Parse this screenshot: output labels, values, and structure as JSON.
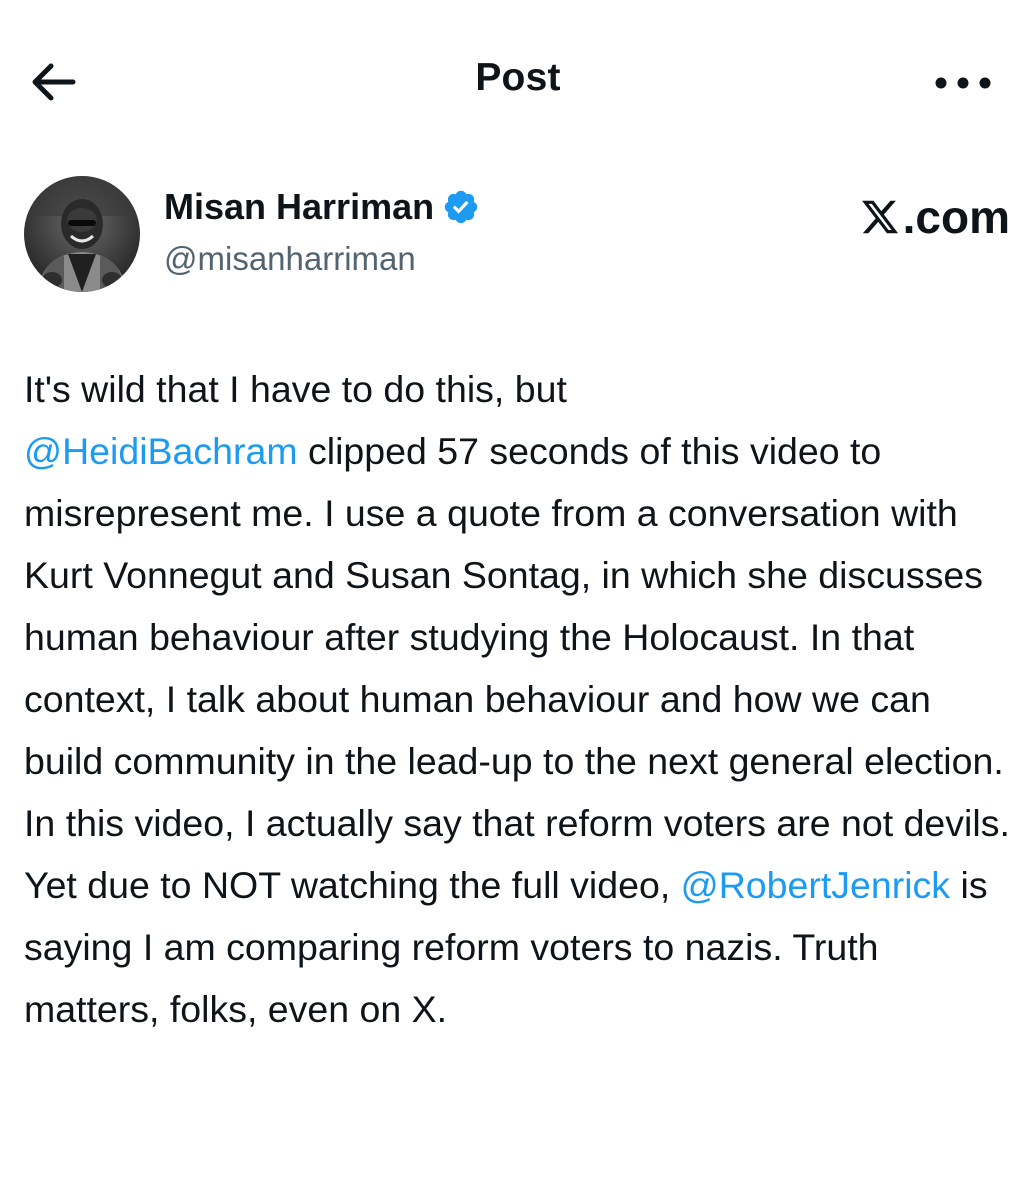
{
  "header": {
    "back_icon": "arrow-left-icon",
    "title": "Post",
    "more_icon": "more-horizontal-icon"
  },
  "author": {
    "display_name": "Misan Harriman",
    "handle": "@misanharriman",
    "verified_icon": "verified-badge-icon",
    "verified_color": "#1d9bf0"
  },
  "brand": {
    "logo_icon": "x-logo-icon",
    "suffix": ".com"
  },
  "post": {
    "text_1": "It's wild that I have to do this, but\n",
    "mention_1": "@HeidiBachram",
    "text_2": " clipped 57 seconds of this video to misrepresent me. I use a quote from a conversation with Kurt Vonnegut and Susan Sontag, in which she discusses human behaviour after studying the Holocaust. In that context, I talk about human behaviour and how we can build community in the lead-up to the next general election. In this video, I actually say that reform voters are not devils. Yet due to NOT watching the full video, ",
    "mention_2": "@RobertJenrick",
    "text_3": " is saying I am comparing reform voters to nazis. Truth matters, folks, even on X.",
    "mention_color": "#1d9bf0"
  }
}
